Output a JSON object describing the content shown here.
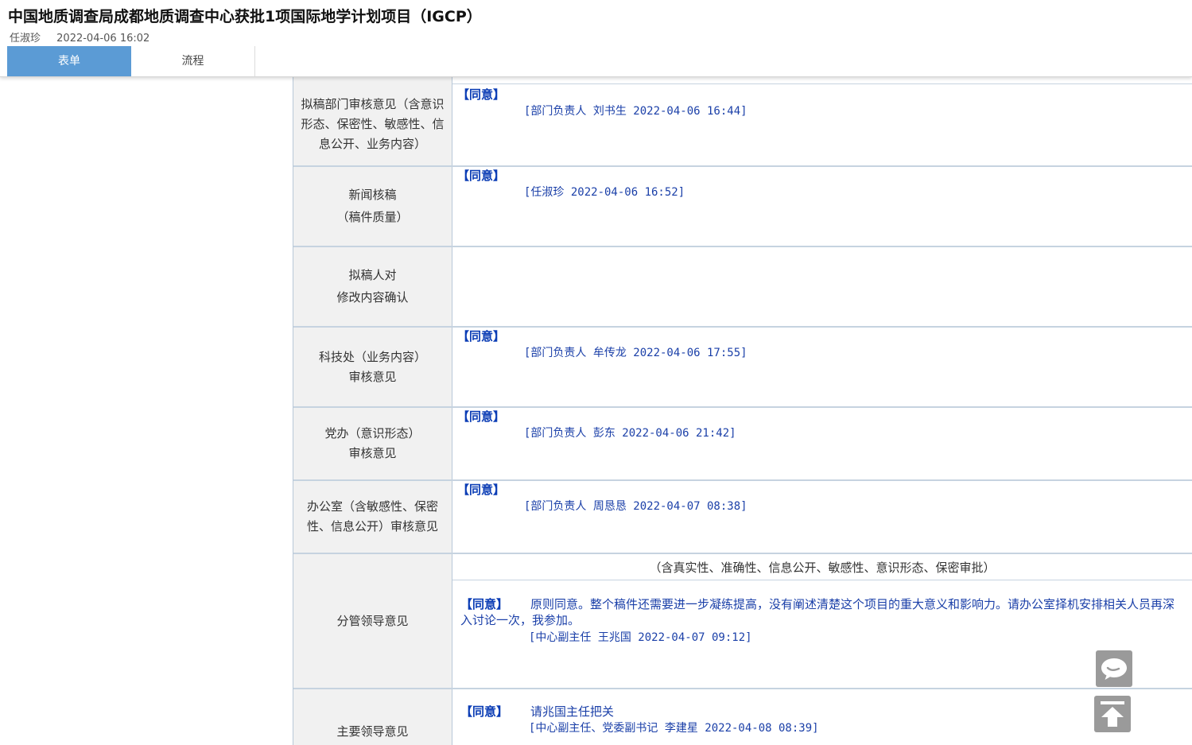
{
  "document": {
    "title": "中国地质调查局成都地质调查中心获批1项国际地学计划项目（IGCP）",
    "author": "任淑珍",
    "timestamp": "2022-04-06 16:02"
  },
  "tabs": [
    {
      "label": "表单",
      "active": true
    },
    {
      "label": "流程",
      "active": false
    }
  ],
  "rows": [
    {
      "label": "拟稿部门审核意见（含意识形态、保密性、敏感性、信息公开、业务内容）",
      "agree": "【同意】",
      "signature": "[部门负责人 刘书生 2022-04-06 16:44]"
    },
    {
      "label_line1": "新闻核稿",
      "label_line2": "（稿件质量）",
      "agree": "【同意】",
      "signature": "[任淑珍 2022-04-06 16:52]"
    },
    {
      "label_line1": "拟稿人对",
      "label_line2": "修改内容确认"
    },
    {
      "label_line1": "科技处（业务内容）",
      "label_line2": "审核意见",
      "agree": "【同意】",
      "signature": "[部门负责人 牟传龙 2022-04-06 17:55]"
    },
    {
      "label_line1": "党办（意识形态）",
      "label_line2": "审核意见",
      "agree": "【同意】",
      "signature": "[部门负责人 彭东 2022-04-06 21:42]"
    },
    {
      "label": "办公室（含敏感性、保密性、信息公开）审核意见",
      "agree": "【同意】",
      "signature": "[部门负责人 周恳恳 2022-04-07 08:38]"
    },
    {
      "label": "分管领导意见",
      "note": "（含真实性、准确性、信息公开、敏感性、意识形态、保密审批）",
      "agree": "【同意】",
      "opinion": "原则同意。整个稿件还需要进一步凝练提高，没有阐述清楚这个项目的重大意义和影响力。请办公室择机安排相关人员再深入讨论一次，我参加。",
      "signature": "[中心副主任 王兆国 2022-04-07 09:12]"
    },
    {
      "label": "主要领导意见",
      "agree": "【同意】",
      "opinion": "请兆国主任把关",
      "signature": "[中心副主任、党委副书记 李建星 2022-04-08 08:39]"
    }
  ],
  "floating": {
    "chat_icon": "chat-bubble-icon",
    "top_icon": "back-to-top-icon"
  }
}
